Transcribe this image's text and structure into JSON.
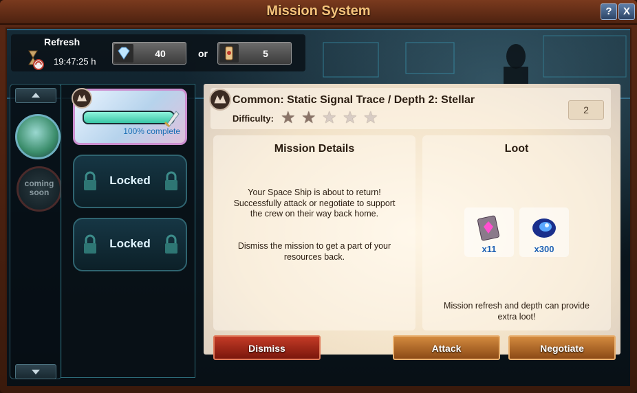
{
  "window": {
    "title": "Mission System",
    "help_button": "?",
    "close_button": "X"
  },
  "refresh": {
    "label": "Refresh",
    "timer": "19:47:25 h",
    "or_label": "or",
    "diamond_cost": "40",
    "scroll_cost": "5"
  },
  "side": {
    "coming_soon": "coming soon"
  },
  "slots": {
    "active_progress_text": "100% complete",
    "active_progress": 1.0,
    "locked_1": "Locked",
    "locked_2": "Locked"
  },
  "mission": {
    "title": "Common: Static Signal Trace / Depth 2: Stellar",
    "difficulty_label": "Difficulty:",
    "difficulty_filled": 2,
    "difficulty_max": 5,
    "counter": "2"
  },
  "details": {
    "heading": "Mission Details",
    "text_1": "Your Space Ship is about to return! Successfully attack or negotiate to support the crew on their way back home.",
    "text_2": "Dismiss the mission to get a part of your resources back."
  },
  "loot": {
    "heading": "Loot",
    "items": [
      {
        "icon": "pink-crystal-card-icon",
        "qty": "x11"
      },
      {
        "icon": "blue-nebula-icon",
        "qty": "x300"
      }
    ],
    "footer": "Mission refresh and depth can provide extra loot!"
  },
  "buttons": {
    "dismiss": "Dismiss",
    "attack": "Attack",
    "negotiate": "Negotiate"
  },
  "colors": {
    "title": "#f5c27a",
    "dismiss": "#a82a1a",
    "action": "#b86a2a",
    "progress": "#39c6a6"
  }
}
